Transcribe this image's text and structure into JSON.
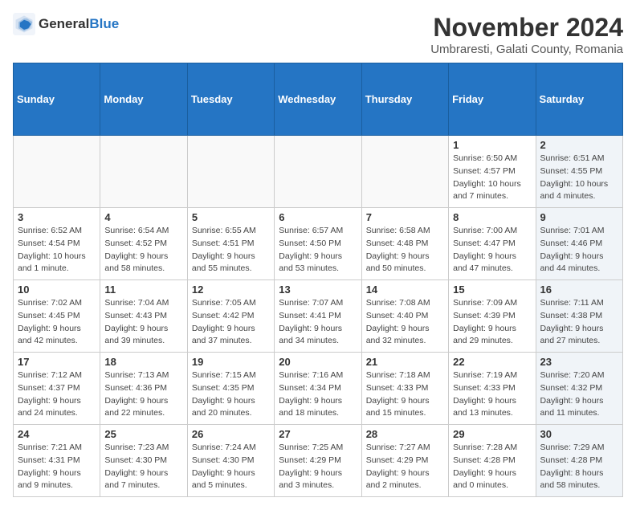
{
  "logo": {
    "general": "General",
    "blue": "Blue"
  },
  "header": {
    "month": "November 2024",
    "location": "Umbraresti, Galati County, Romania"
  },
  "weekdays": [
    "Sunday",
    "Monday",
    "Tuesday",
    "Wednesday",
    "Thursday",
    "Friday",
    "Saturday"
  ],
  "weeks": [
    [
      {
        "day": "",
        "info": ""
      },
      {
        "day": "",
        "info": ""
      },
      {
        "day": "",
        "info": ""
      },
      {
        "day": "",
        "info": ""
      },
      {
        "day": "",
        "info": ""
      },
      {
        "day": "1",
        "info": "Sunrise: 6:50 AM\nSunset: 4:57 PM\nDaylight: 10 hours and 7 minutes."
      },
      {
        "day": "2",
        "info": "Sunrise: 6:51 AM\nSunset: 4:55 PM\nDaylight: 10 hours and 4 minutes."
      }
    ],
    [
      {
        "day": "3",
        "info": "Sunrise: 6:52 AM\nSunset: 4:54 PM\nDaylight: 10 hours and 1 minute."
      },
      {
        "day": "4",
        "info": "Sunrise: 6:54 AM\nSunset: 4:52 PM\nDaylight: 9 hours and 58 minutes."
      },
      {
        "day": "5",
        "info": "Sunrise: 6:55 AM\nSunset: 4:51 PM\nDaylight: 9 hours and 55 minutes."
      },
      {
        "day": "6",
        "info": "Sunrise: 6:57 AM\nSunset: 4:50 PM\nDaylight: 9 hours and 53 minutes."
      },
      {
        "day": "7",
        "info": "Sunrise: 6:58 AM\nSunset: 4:48 PM\nDaylight: 9 hours and 50 minutes."
      },
      {
        "day": "8",
        "info": "Sunrise: 7:00 AM\nSunset: 4:47 PM\nDaylight: 9 hours and 47 minutes."
      },
      {
        "day": "9",
        "info": "Sunrise: 7:01 AM\nSunset: 4:46 PM\nDaylight: 9 hours and 44 minutes."
      }
    ],
    [
      {
        "day": "10",
        "info": "Sunrise: 7:02 AM\nSunset: 4:45 PM\nDaylight: 9 hours and 42 minutes."
      },
      {
        "day": "11",
        "info": "Sunrise: 7:04 AM\nSunset: 4:43 PM\nDaylight: 9 hours and 39 minutes."
      },
      {
        "day": "12",
        "info": "Sunrise: 7:05 AM\nSunset: 4:42 PM\nDaylight: 9 hours and 37 minutes."
      },
      {
        "day": "13",
        "info": "Sunrise: 7:07 AM\nSunset: 4:41 PM\nDaylight: 9 hours and 34 minutes."
      },
      {
        "day": "14",
        "info": "Sunrise: 7:08 AM\nSunset: 4:40 PM\nDaylight: 9 hours and 32 minutes."
      },
      {
        "day": "15",
        "info": "Sunrise: 7:09 AM\nSunset: 4:39 PM\nDaylight: 9 hours and 29 minutes."
      },
      {
        "day": "16",
        "info": "Sunrise: 7:11 AM\nSunset: 4:38 PM\nDaylight: 9 hours and 27 minutes."
      }
    ],
    [
      {
        "day": "17",
        "info": "Sunrise: 7:12 AM\nSunset: 4:37 PM\nDaylight: 9 hours and 24 minutes."
      },
      {
        "day": "18",
        "info": "Sunrise: 7:13 AM\nSunset: 4:36 PM\nDaylight: 9 hours and 22 minutes."
      },
      {
        "day": "19",
        "info": "Sunrise: 7:15 AM\nSunset: 4:35 PM\nDaylight: 9 hours and 20 minutes."
      },
      {
        "day": "20",
        "info": "Sunrise: 7:16 AM\nSunset: 4:34 PM\nDaylight: 9 hours and 18 minutes."
      },
      {
        "day": "21",
        "info": "Sunrise: 7:18 AM\nSunset: 4:33 PM\nDaylight: 9 hours and 15 minutes."
      },
      {
        "day": "22",
        "info": "Sunrise: 7:19 AM\nSunset: 4:33 PM\nDaylight: 9 hours and 13 minutes."
      },
      {
        "day": "23",
        "info": "Sunrise: 7:20 AM\nSunset: 4:32 PM\nDaylight: 9 hours and 11 minutes."
      }
    ],
    [
      {
        "day": "24",
        "info": "Sunrise: 7:21 AM\nSunset: 4:31 PM\nDaylight: 9 hours and 9 minutes."
      },
      {
        "day": "25",
        "info": "Sunrise: 7:23 AM\nSunset: 4:30 PM\nDaylight: 9 hours and 7 minutes."
      },
      {
        "day": "26",
        "info": "Sunrise: 7:24 AM\nSunset: 4:30 PM\nDaylight: 9 hours and 5 minutes."
      },
      {
        "day": "27",
        "info": "Sunrise: 7:25 AM\nSunset: 4:29 PM\nDaylight: 9 hours and 3 minutes."
      },
      {
        "day": "28",
        "info": "Sunrise: 7:27 AM\nSunset: 4:29 PM\nDaylight: 9 hours and 2 minutes."
      },
      {
        "day": "29",
        "info": "Sunrise: 7:28 AM\nSunset: 4:28 PM\nDaylight: 9 hours and 0 minutes."
      },
      {
        "day": "30",
        "info": "Sunrise: 7:29 AM\nSunset: 4:28 PM\nDaylight: 8 hours and 58 minutes."
      }
    ]
  ]
}
